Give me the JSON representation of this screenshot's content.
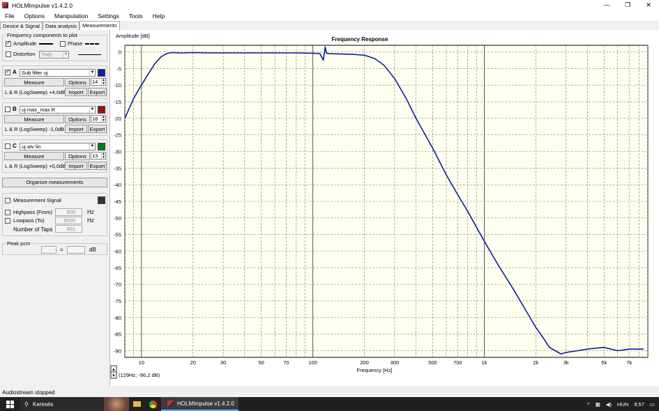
{
  "window": {
    "title": "HOLMImpulse  v1.4.2.0",
    "minimize": "—",
    "restore": "❐",
    "close": "✕"
  },
  "menu": [
    "File",
    "Options",
    "Manipulation",
    "Settings",
    "Tools",
    "Help"
  ],
  "tabs": [
    "Device & Signal",
    "Data analysis",
    "Measurements"
  ],
  "freq_group": {
    "title": "Frequency components to plot",
    "amplitude": "Amplitude",
    "phase": "Phase",
    "distortion": "Distortion",
    "distortion_select": "THD"
  },
  "measurements": [
    {
      "letter": "A",
      "name": "Sub filter uj",
      "checked": true,
      "color": "#0a1f9e",
      "measure": "Measure",
      "options": "Options",
      "spin": "14",
      "info": "L & R (LogSweep) +4,0dB",
      "import": "Import",
      "export": "Export"
    },
    {
      "letter": "B",
      "name": "uj max_max R",
      "checked": false,
      "color": "#9e1010",
      "measure": "Measure",
      "options": "Options",
      "spin": "18",
      "info": "L & R (LogSweep) -1,0dB",
      "import": "Import",
      "export": "Export"
    },
    {
      "letter": "C",
      "name": "uj atv lin",
      "checked": false,
      "color": "#0b7a14",
      "measure": "Measure",
      "options": "Options",
      "spin": "13",
      "info": "L & R (LogSweep) +0,0dB",
      "import": "Import",
      "export": "Export"
    }
  ],
  "organize": "Organize measurements",
  "meas_signal": {
    "label": "Measurement Signal",
    "highpass": "Highpass (From)",
    "highpass_val": "500",
    "lowpass": "Lowpass (To)",
    "lowpass_val": "5000",
    "taps": "Number of Taps",
    "taps_val": "501",
    "hz": "Hz"
  },
  "peak": {
    "title": "Peak pcm",
    "eq": "=",
    "unit": "dB"
  },
  "status": "Audiostream stopped",
  "cursor_readout": "(129Hz; -96,2 dB)",
  "taskbar": {
    "search": "Keresés",
    "app": "HOLMImpulse  v1.4.2.0",
    "lang": "HUN",
    "time": "9:57"
  },
  "chart_data": {
    "type": "line",
    "title": "Frequency Response",
    "xlabel": "Frequency [Hz]",
    "ylabel": "Amplitude [dB]",
    "xscale": "log",
    "xlim": [
      8,
      9000
    ],
    "ylim": [
      -92,
      2
    ],
    "x_ticks": [
      10,
      20,
      30,
      50,
      70,
      100,
      200,
      300,
      500,
      700,
      1000,
      2000,
      3000,
      5000,
      7000
    ],
    "x_tick_labels": [
      "10",
      "20",
      "30",
      "50",
      "70",
      "100",
      "200",
      "300",
      "500",
      "700",
      "1k",
      "2k",
      "3k",
      "5k",
      "7k"
    ],
    "y_ticks": [
      0,
      -5,
      -10,
      -15,
      -20,
      -25,
      -30,
      -35,
      -40,
      -45,
      -50,
      -55,
      -60,
      -65,
      -70,
      -75,
      -80,
      -85,
      -90
    ],
    "grid": true,
    "series": [
      {
        "color": "#0a1f9e",
        "x": [
          8,
          9,
          10,
          11,
          12,
          13,
          14,
          15,
          17,
          20,
          25,
          30,
          50,
          80,
          100,
          110,
          115,
          118,
          120,
          125,
          140,
          170,
          200,
          230,
          260,
          300,
          350,
          400,
          500,
          600,
          700,
          800,
          1000,
          1200,
          1500,
          1800,
          2000,
          2200,
          2400,
          2600,
          2800,
          3000,
          3500,
          4000,
          5000,
          6000,
          7000,
          8000,
          8500
        ],
        "y": [
          -20,
          -14,
          -10,
          -6.5,
          -3.5,
          -1.5,
          -0.5,
          -0.2,
          -0.3,
          -0.2,
          -0.3,
          -0.3,
          -0.3,
          -0.3,
          -0.4,
          -0.5,
          -2.5,
          1.5,
          -0.4,
          -0.5,
          -0.6,
          -0.7,
          -1,
          -2,
          -4,
          -8,
          -14,
          -20,
          -29,
          -37,
          -43,
          -48,
          -57,
          -64,
          -72,
          -79,
          -83,
          -86,
          -89,
          -90,
          -91,
          -90.5,
          -90,
          -89.5,
          -89,
          -90,
          -89.5,
          -89.5,
          -89.5
        ]
      }
    ]
  }
}
